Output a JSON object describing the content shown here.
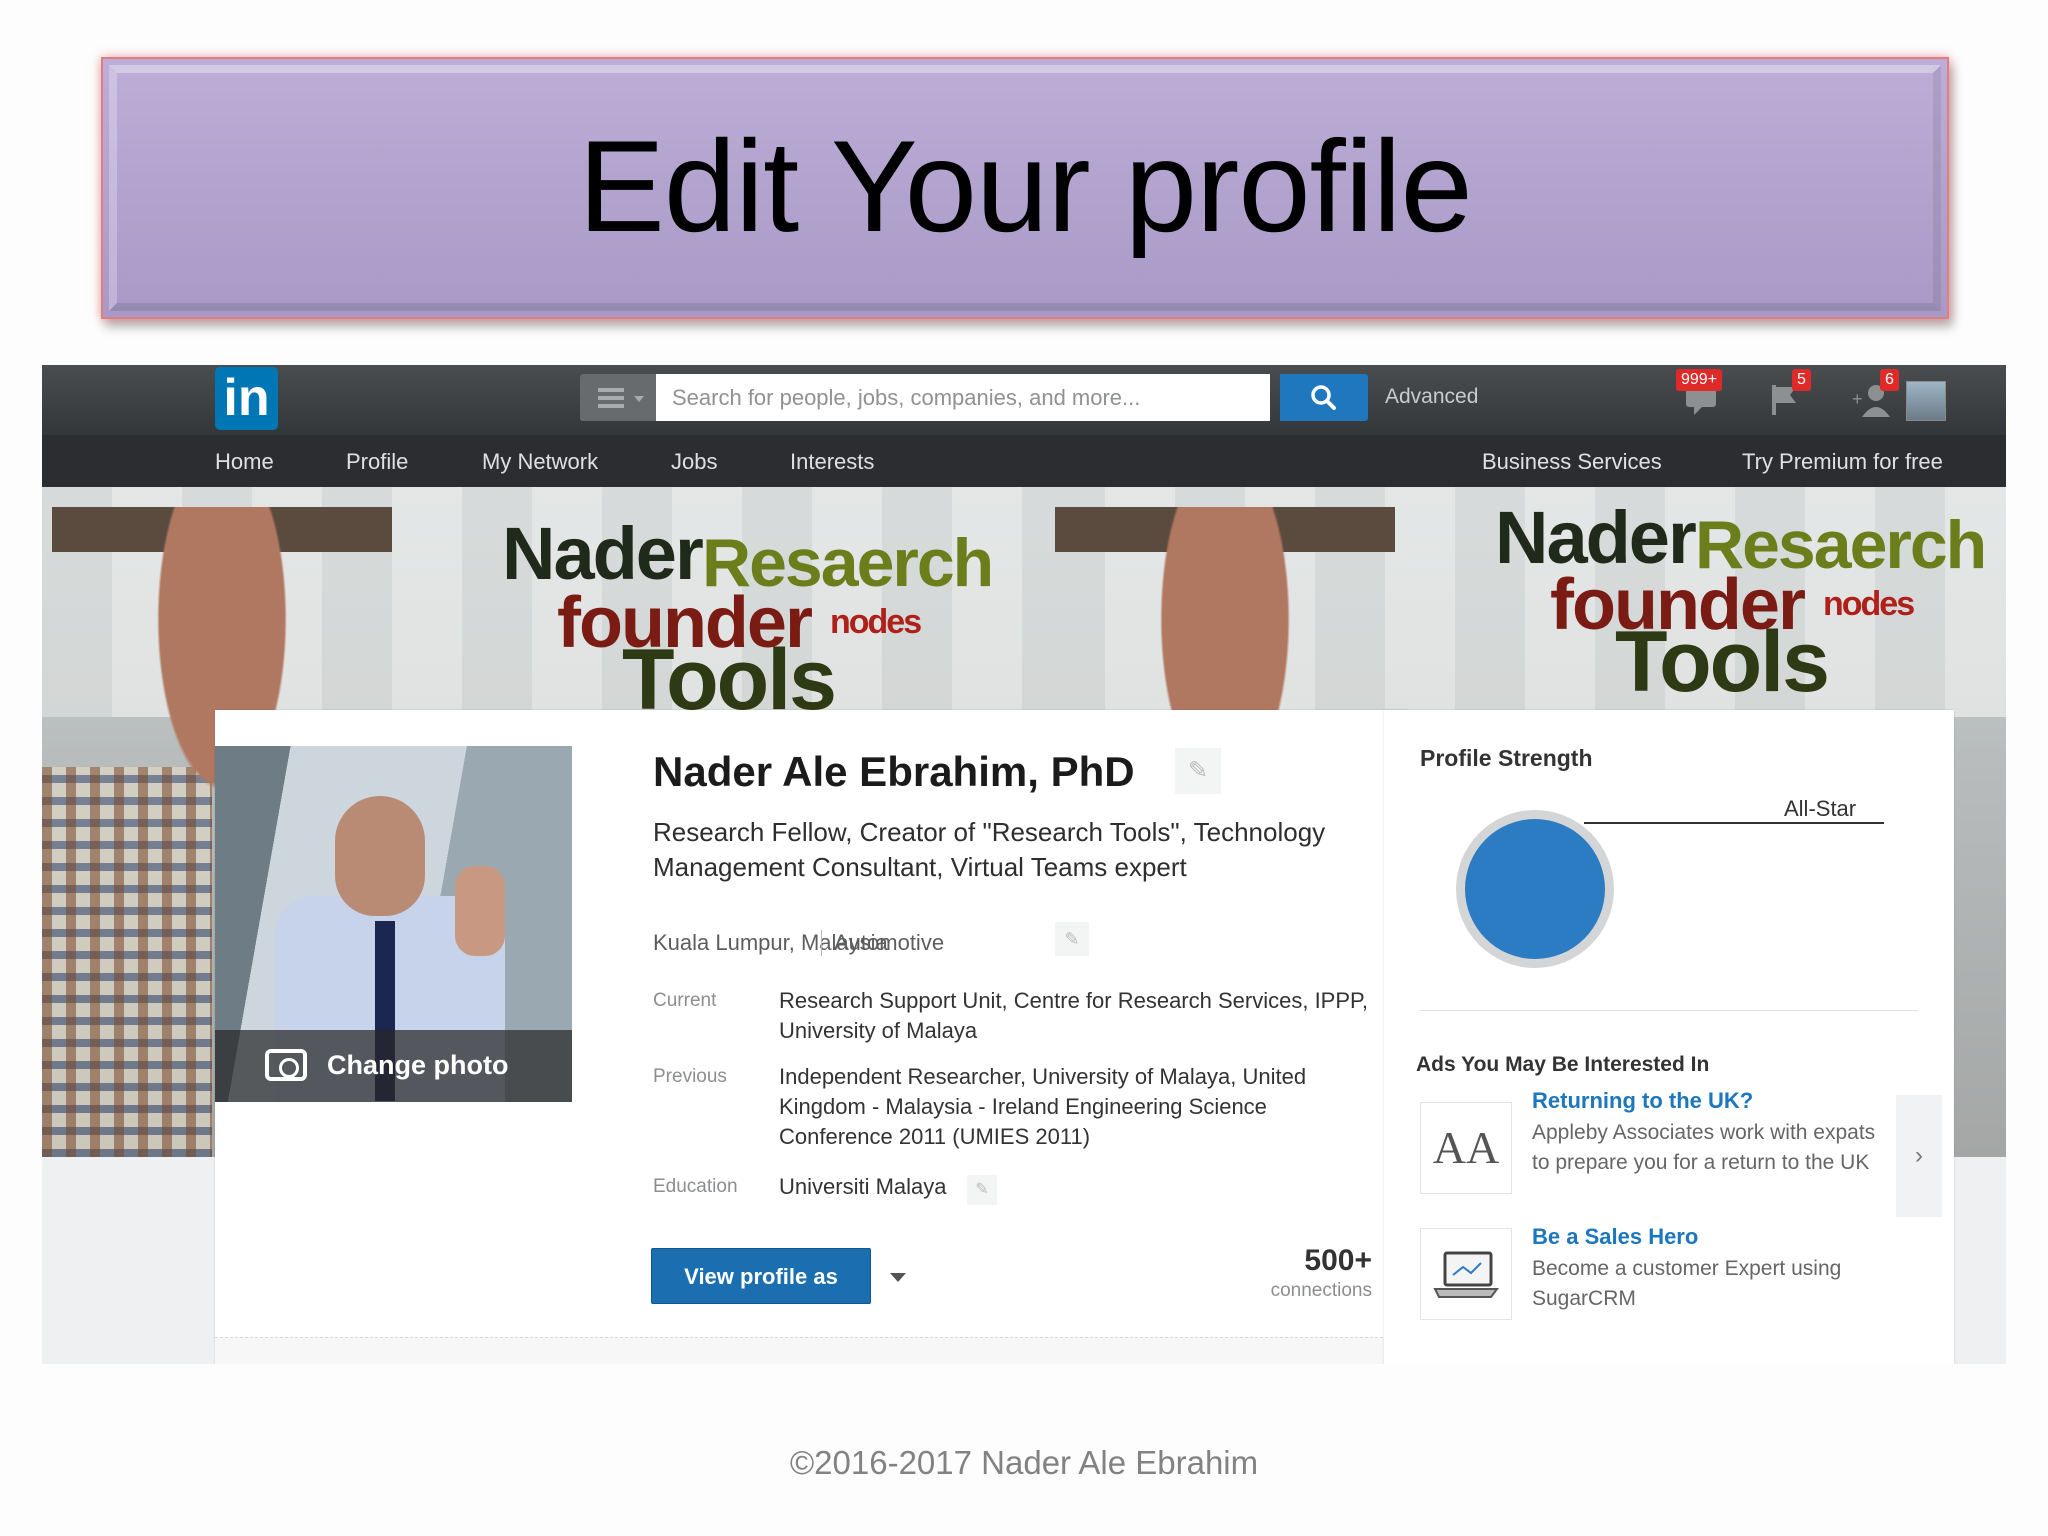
{
  "slide": {
    "title": "Edit Your profile",
    "footer": "©2016-2017  Nader Ale Ebrahim"
  },
  "topbar": {
    "logo": "in",
    "search_placeholder": "Search for people, jobs, companies, and more...",
    "advanced_label": "Advanced",
    "messages_badge": "999+",
    "notifications_badge": "5",
    "add_connections_badge": "6",
    "icons": [
      "menu-icon",
      "search-icon",
      "messages-icon",
      "flag-icon",
      "add-connection-icon",
      "account-avatar"
    ]
  },
  "nav": {
    "items": [
      "Home",
      "Profile",
      "My Network",
      "Jobs",
      "Interests"
    ],
    "right_items": [
      "Business Services",
      "Try Premium for free"
    ]
  },
  "background": {
    "cloud_words": [
      "Nader",
      "Resaerch",
      "founder",
      "nodes",
      "Tools"
    ]
  },
  "profile": {
    "change_photo_label": "Change photo",
    "name": "Nader Ale Ebrahim, PhD",
    "headline": "Research Fellow, Creator of \"Research Tools\", Technology Management Consultant, Virtual Teams expert",
    "location": "Kuala Lumpur, Malaysia",
    "industry": "Automotive",
    "current_label": "Current",
    "current_value": "Research Support Unit, Centre for Research Services, IPPP, University of Malaya",
    "previous_label": "Previous",
    "previous_value": "Independent Researcher, University of Malaya, United Kingdom - Malaysia - Ireland Engineering Science Conference 2011 (UMIES 2011)",
    "education_label": "Education",
    "education_value": "Universiti Malaya",
    "view_profile_button": "View profile as",
    "connections_count": "500+",
    "connections_label": "connections"
  },
  "side": {
    "profile_strength_title": "Profile Strength",
    "strength_level": "All-Star",
    "ads_title": "Ads You May Be Interested In",
    "ads": [
      {
        "logo": "AA",
        "headline": "Returning to the UK?",
        "body": "Appleby Associates work with expats to prepare you for a return to the UK"
      },
      {
        "logo": "laptop-icon",
        "headline": "Be a Sales Hero",
        "body": "Become a customer Expert using SugarCRM"
      }
    ]
  },
  "colors": {
    "banner_fill": "#ad9fcc",
    "banner_border": "#e27e82",
    "linkedin_blue": "#0077b5",
    "button_blue": "#1b6fb0",
    "strength_blue": "#2b7cc2",
    "badge_red": "#e02a2a"
  }
}
